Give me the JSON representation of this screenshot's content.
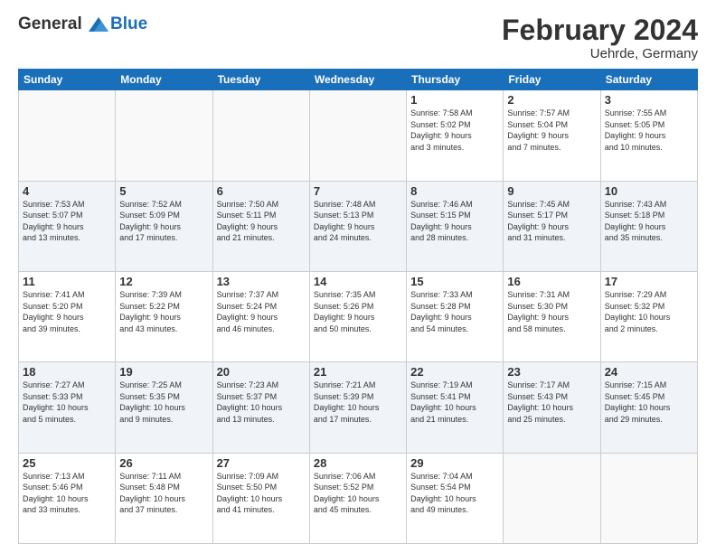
{
  "logo": {
    "line1": "General",
    "line2": "Blue"
  },
  "title": "February 2024",
  "subtitle": "Uehrde, Germany",
  "weekdays": [
    "Sunday",
    "Monday",
    "Tuesday",
    "Wednesday",
    "Thursday",
    "Friday",
    "Saturday"
  ],
  "weeks": [
    [
      {
        "day": "",
        "info": ""
      },
      {
        "day": "",
        "info": ""
      },
      {
        "day": "",
        "info": ""
      },
      {
        "day": "",
        "info": ""
      },
      {
        "day": "1",
        "info": "Sunrise: 7:58 AM\nSunset: 5:02 PM\nDaylight: 9 hours\nand 3 minutes."
      },
      {
        "day": "2",
        "info": "Sunrise: 7:57 AM\nSunset: 5:04 PM\nDaylight: 9 hours\nand 7 minutes."
      },
      {
        "day": "3",
        "info": "Sunrise: 7:55 AM\nSunset: 5:05 PM\nDaylight: 9 hours\nand 10 minutes."
      }
    ],
    [
      {
        "day": "4",
        "info": "Sunrise: 7:53 AM\nSunset: 5:07 PM\nDaylight: 9 hours\nand 13 minutes."
      },
      {
        "day": "5",
        "info": "Sunrise: 7:52 AM\nSunset: 5:09 PM\nDaylight: 9 hours\nand 17 minutes."
      },
      {
        "day": "6",
        "info": "Sunrise: 7:50 AM\nSunset: 5:11 PM\nDaylight: 9 hours\nand 21 minutes."
      },
      {
        "day": "7",
        "info": "Sunrise: 7:48 AM\nSunset: 5:13 PM\nDaylight: 9 hours\nand 24 minutes."
      },
      {
        "day": "8",
        "info": "Sunrise: 7:46 AM\nSunset: 5:15 PM\nDaylight: 9 hours\nand 28 minutes."
      },
      {
        "day": "9",
        "info": "Sunrise: 7:45 AM\nSunset: 5:17 PM\nDaylight: 9 hours\nand 31 minutes."
      },
      {
        "day": "10",
        "info": "Sunrise: 7:43 AM\nSunset: 5:18 PM\nDaylight: 9 hours\nand 35 minutes."
      }
    ],
    [
      {
        "day": "11",
        "info": "Sunrise: 7:41 AM\nSunset: 5:20 PM\nDaylight: 9 hours\nand 39 minutes."
      },
      {
        "day": "12",
        "info": "Sunrise: 7:39 AM\nSunset: 5:22 PM\nDaylight: 9 hours\nand 43 minutes."
      },
      {
        "day": "13",
        "info": "Sunrise: 7:37 AM\nSunset: 5:24 PM\nDaylight: 9 hours\nand 46 minutes."
      },
      {
        "day": "14",
        "info": "Sunrise: 7:35 AM\nSunset: 5:26 PM\nDaylight: 9 hours\nand 50 minutes."
      },
      {
        "day": "15",
        "info": "Sunrise: 7:33 AM\nSunset: 5:28 PM\nDaylight: 9 hours\nand 54 minutes."
      },
      {
        "day": "16",
        "info": "Sunrise: 7:31 AM\nSunset: 5:30 PM\nDaylight: 9 hours\nand 58 minutes."
      },
      {
        "day": "17",
        "info": "Sunrise: 7:29 AM\nSunset: 5:32 PM\nDaylight: 10 hours\nand 2 minutes."
      }
    ],
    [
      {
        "day": "18",
        "info": "Sunrise: 7:27 AM\nSunset: 5:33 PM\nDaylight: 10 hours\nand 5 minutes."
      },
      {
        "day": "19",
        "info": "Sunrise: 7:25 AM\nSunset: 5:35 PM\nDaylight: 10 hours\nand 9 minutes."
      },
      {
        "day": "20",
        "info": "Sunrise: 7:23 AM\nSunset: 5:37 PM\nDaylight: 10 hours\nand 13 minutes."
      },
      {
        "day": "21",
        "info": "Sunrise: 7:21 AM\nSunset: 5:39 PM\nDaylight: 10 hours\nand 17 minutes."
      },
      {
        "day": "22",
        "info": "Sunrise: 7:19 AM\nSunset: 5:41 PM\nDaylight: 10 hours\nand 21 minutes."
      },
      {
        "day": "23",
        "info": "Sunrise: 7:17 AM\nSunset: 5:43 PM\nDaylight: 10 hours\nand 25 minutes."
      },
      {
        "day": "24",
        "info": "Sunrise: 7:15 AM\nSunset: 5:45 PM\nDaylight: 10 hours\nand 29 minutes."
      }
    ],
    [
      {
        "day": "25",
        "info": "Sunrise: 7:13 AM\nSunset: 5:46 PM\nDaylight: 10 hours\nand 33 minutes."
      },
      {
        "day": "26",
        "info": "Sunrise: 7:11 AM\nSunset: 5:48 PM\nDaylight: 10 hours\nand 37 minutes."
      },
      {
        "day": "27",
        "info": "Sunrise: 7:09 AM\nSunset: 5:50 PM\nDaylight: 10 hours\nand 41 minutes."
      },
      {
        "day": "28",
        "info": "Sunrise: 7:06 AM\nSunset: 5:52 PM\nDaylight: 10 hours\nand 45 minutes."
      },
      {
        "day": "29",
        "info": "Sunrise: 7:04 AM\nSunset: 5:54 PM\nDaylight: 10 hours\nand 49 minutes."
      },
      {
        "day": "",
        "info": ""
      },
      {
        "day": "",
        "info": ""
      }
    ]
  ]
}
